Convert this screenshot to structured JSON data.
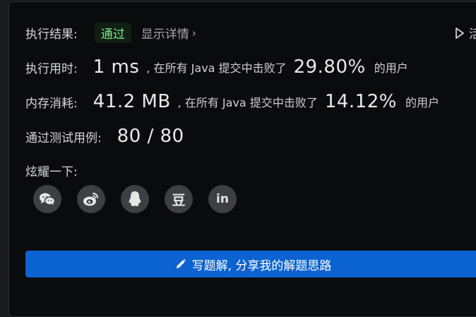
{
  "result": {
    "label": "执行结果:",
    "status": "通过",
    "details_link": "显示详情",
    "run_label": "活"
  },
  "runtime": {
    "label": "执行用时:",
    "value": "1 ms",
    "middle_text": ", 在所有 Java 提交中击败了",
    "percent": "29.80%",
    "suffix": "的用户"
  },
  "memory": {
    "label": "内存消耗:",
    "value": "41.2 MB",
    "middle_text": ", 在所有 Java 提交中击败了",
    "percent": "14.12%",
    "suffix": "的用户"
  },
  "testcases": {
    "label": "通过测试用例:",
    "value": "80 / 80"
  },
  "share": {
    "label": "炫耀一下:",
    "buttons": [
      {
        "icon": "wechat-icon"
      },
      {
        "icon": "weibo-icon"
      },
      {
        "icon": "qq-icon"
      },
      {
        "icon": "douban-icon",
        "text": "豆"
      },
      {
        "icon": "linkedin-icon",
        "text": "in"
      }
    ]
  },
  "write_solution": {
    "label": "写题解, 分享我的解题思路",
    "icon": "pencil-icon"
  },
  "colors": {
    "panel_bg": "#0a0b0d",
    "pass_green": "#7ee787",
    "button_blue": "#0a63d1"
  }
}
